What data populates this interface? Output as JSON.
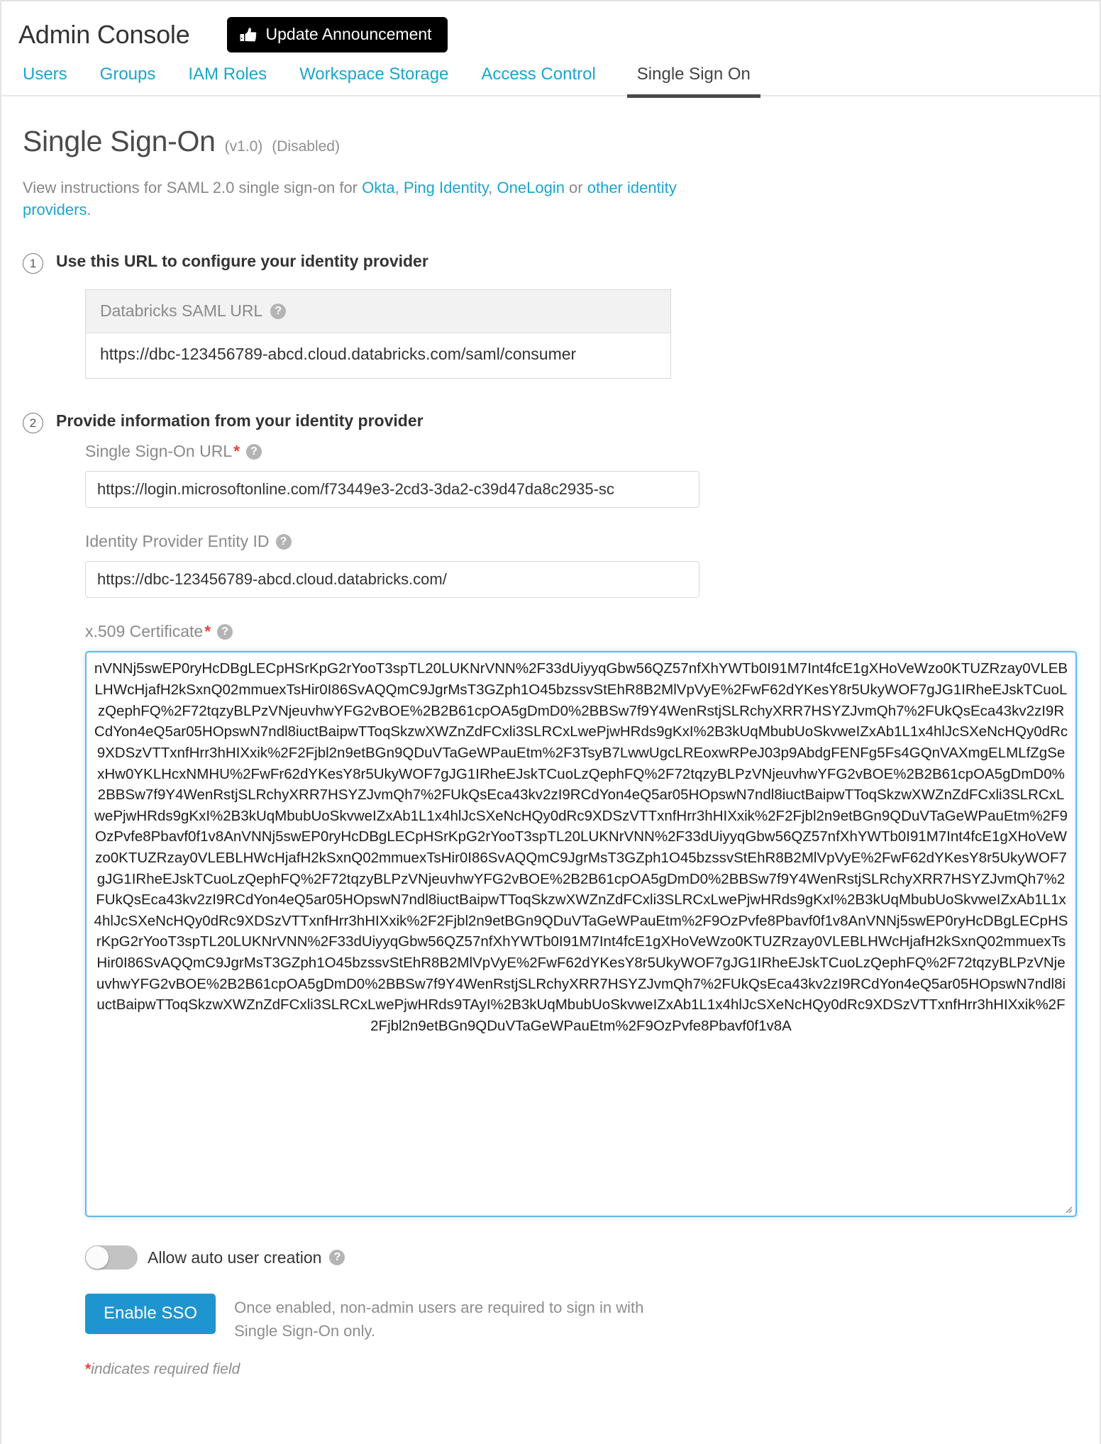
{
  "header": {
    "console_title": "Admin Console",
    "announcement_label": "Update Announcement",
    "announcement_icon": "thumbs-up-icon"
  },
  "tabs": [
    {
      "label": "Users",
      "active": false
    },
    {
      "label": "Groups",
      "active": false
    },
    {
      "label": "IAM Roles",
      "active": false
    },
    {
      "label": "Workspace Storage",
      "active": false
    },
    {
      "label": "Access Control",
      "active": false
    },
    {
      "label": "Single Sign On",
      "active": true
    }
  ],
  "page": {
    "title": "Single Sign-On",
    "version": "(v1.0)",
    "status": "(Disabled)",
    "intro_prefix": "View instructions for SAML 2.0 single sign-on for ",
    "intro_links": [
      "Okta",
      "Ping Identity",
      "OneLogin",
      "other identity providers"
    ],
    "intro_sep1": ", ",
    "intro_sep2": ", ",
    "intro_mid": " or ",
    "intro_suffix": "."
  },
  "step1": {
    "number": "1",
    "label": "Use this URL to configure your identity provider",
    "saml_url_label": "Databricks SAML URL",
    "saml_url_value": "https://dbc-123456789-abcd.cloud.databricks.com/saml/consumer",
    "help_glyph": "?"
  },
  "step2": {
    "number": "2",
    "label": "Provide information from your identity provider",
    "fields": [
      {
        "label": "Single Sign-On URL",
        "required": true,
        "value": "https://login.microsoftonline.com/f73449e3-2cd3-3da2-c39d47da8c2935-sc",
        "placeholder": ""
      },
      {
        "label": "Identity Provider Entity ID",
        "required": false,
        "value": "https://dbc-123456789-abcd.cloud.databricks.com/",
        "placeholder": ""
      }
    ],
    "cert_label": "x.509 Certificate",
    "cert_required": true,
    "cert_value": "nVNNj5swEP0ryHcDBgLECpHSrKpG2rYooT3spTL20LUKNrVNN%2F33dUiyyqGbw56QZ57nfXhYWTb0I91M7Int4fcE1gXHoVeWzo0KTUZRzay0VLEBLHWcHjafH2kSxnQ02mmuexTsHir0I86SvAQQmC9JgrMsT3GZph1O45bzssvStEhR8B2MlVpVyE%2FwF62dYKesY8r5UkyWOF7gJG1IRheEJskTCuoLzQephFQ%2F72tqzyBLPzVNjeuvhwYFG2vBOE%2B2B61cpOA5gDmD0%2BBSw7f9Y4WenRstjSLRchyXRR7HSYZJvmQh7%2FUkQsEca43kv2zI9RCdYon4eQ5ar05HOpswN7ndl8iuctBaipwTToqSkzwXWZnZdFCxli3SLRCxLwePjwHRds9gKxI%2B3kUqMbubUoSkvweIZxAb1L1x4hlJcSXeNcHQy0dRc9XDSzVTTxnfHrr3hHIXxik%2F2Fjbl2n9etBGn9QDuVTaGeWPauEtm%2F3TsyB7LwwUgcLREoxwRPeJ03p9AbdgFENFg5Fs4GQnVAXmgELMLfZgSexHw0YKLHcxNMHU%2FwFr62dYKesY8r5UkyWOF7gJG1IRheEJskTCuoLzQephFQ%2F72tqzyBLPzVNjeuvhwYFG2vBOE%2B2B61cpOA5gDmD0%2BBSw7f9Y4WenRstjSLRchyXRR7HSYZJvmQh7%2FUkQsEca43kv2zI9RCdYon4eQ5ar05HOpswN7ndl8iuctBaipwTToqSkzwXWZnZdFCxli3SLRCxLwePjwHRds9gKxI%2B3kUqMbubUoSkvweIZxAb1L1x4hlJcSXeNcHQy0dRc9XDSzVTTxnfHrr3hHIXxik%2F2Fjbl2n9etBGn9QDuVTaGeWPauEtm%2F9OzPvfe8Pbavf0f1v8AnVNNj5swEP0ryHcDBgLECpHSrKpG2rYooT3spTL20LUKNrVNN%2F33dUiyyqGbw56QZ57nfXhYWTb0I91M7Int4fcE1gXHoVeWzo0KTUZRzay0VLEBLHWcHjafH2kSxnQ02mmuexTsHir0I86SvAQQmC9JgrMsT3GZph1O45bzssvStEhR8B2MlVpVyE%2FwF62dYKesY8r5UkyWOF7gJG1IRheEJskTCuoLzQephFQ%2F72tqzyBLPzVNjeuvhwYFG2vBOE%2B2B61cpOA5gDmD0%2BBSw7f9Y4WenRstjSLRchyXRR7HSYZJvmQh7%2FUkQsEca43kv2zI9RCdYon4eQ5ar05HOpswN7ndl8iuctBaipwTToqSkzwXWZnZdFCxli3SLRCxLwePjwHRds9gKxI%2B3kUqMbubUoSkvweIZxAb1L1x4hlJcSXeNcHQy0dRc9XDSzVTTxnfHrr3hHIXxik%2F2Fjbl2n9etBGn9QDuVTaGeWPauEtm%2F9OzPvfe8Pbavf0f1v8AnVNNj5swEP0ryHcDBgLECpHSrKpG2rYooT3spTL20LUKNrVNN%2F33dUiyyqGbw56QZ57nfXhYWTb0I91M7Int4fcE1gXHoVeWzo0KTUZRzay0VLEBLHWcHjafH2kSxnQ02mmuexTsHir0I86SvAQQmC9JgrMsT3GZph1O45bzssvStEhR8B2MlVpVyE%2FwF62dYKesY8r5UkyWOF7gJG1IRheEJskTCuoLzQephFQ%2F72tqzyBLPzVNjeuvhwYFG2vBOE%2B2B61cpOA5gDmD0%2BBSw7f9Y4WenRstjSLRchyXRR7HSYZJvmQh7%2FUkQsEca43kv2zI9RCdYon4eQ5ar05HOpswN7ndl8iuctBaipwTToqSkzwXWZnZdFCxli3SLRCxLwePjwHRds9TAyI%2B3kUqMbubUoSkvweIZxAb1L1x4hlJcSXeNcHQy0dRc9XDSzVTTxnfHrr3hHIXxik%2F2Fjbl2n9etBGn9QDuVTaGeWPauEtm%2F9OzPvfe8Pbavf0f1v8A",
    "cert_placeholder": ""
  },
  "footer": {
    "toggle_label": "Allow auto user creation",
    "toggle_on": false,
    "enable_button": "Enable SSO",
    "enable_note_line1": "Once enabled, non-admin users are required to sign in with",
    "enable_note_line2": "Single Sign-On only.",
    "required_star": "*",
    "required_note": "indicates required field"
  },
  "colors": {
    "link": "#1ba5ce",
    "primary_button": "#1f95d0",
    "focus_border": "#63b8e8",
    "required": "#e8413c",
    "active_tab_underline": "#4a4a4a"
  }
}
